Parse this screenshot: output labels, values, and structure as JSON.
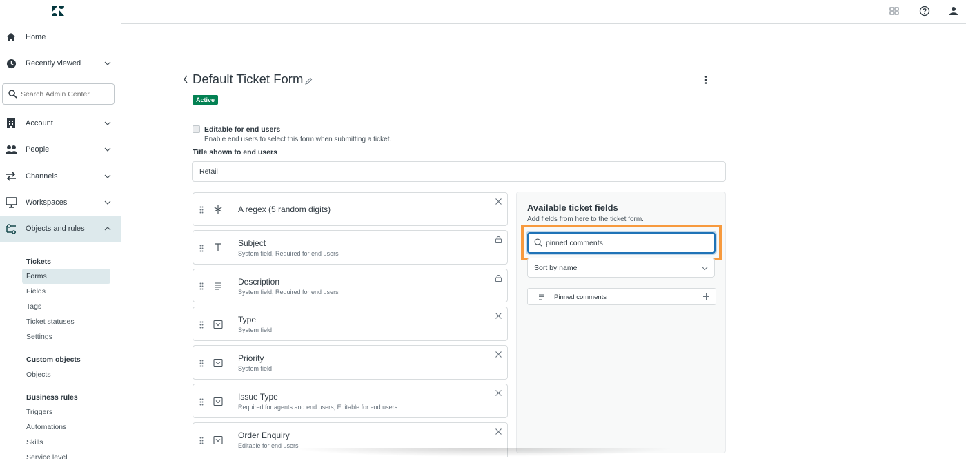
{
  "nav": {
    "home": "Home",
    "recently_viewed": "Recently viewed",
    "search_placeholder": "Search Admin Center",
    "account": "Account",
    "people": "People",
    "channels": "Channels",
    "workspaces": "Workspaces",
    "objects_and_rules": "Objects and rules"
  },
  "subnav": {
    "tickets_heading": "Tickets",
    "tickets_items": [
      "Forms",
      "Fields",
      "Tags",
      "Ticket statuses",
      "Settings"
    ],
    "custom_objects_heading": "Custom objects",
    "custom_objects_items": [
      "Objects"
    ],
    "business_rules_heading": "Business rules",
    "business_rules_items": [
      "Triggers",
      "Automations",
      "Skills",
      "Service level"
    ]
  },
  "form": {
    "title": "Default Ticket Form",
    "status_badge": "Active",
    "editable_label": "Editable for end users",
    "editable_hint": "Enable end users to select this form when submitting a ticket.",
    "title_label": "Title shown to end users",
    "title_value": "Retail"
  },
  "fields": [
    {
      "name": "A regex (5 random digits)",
      "sub": ""
    },
    {
      "name": "Subject",
      "sub": "System field, Required for end users"
    },
    {
      "name": "Description",
      "sub": "System field, Required for end users"
    },
    {
      "name": "Type",
      "sub": "System field"
    },
    {
      "name": "Priority",
      "sub": "System field"
    },
    {
      "name": "Issue Type",
      "sub": "Required for agents and end users, Editable for end users"
    },
    {
      "name": "Order Enquiry",
      "sub": "Editable for end users"
    }
  ],
  "panel": {
    "title": "Available ticket fields",
    "subtitle": "Add fields from here to the ticket form.",
    "search_value": "pinned comments",
    "sort_label": "Sort by name",
    "results": [
      "Pinned comments"
    ]
  },
  "colors": {
    "active_badge": "#038153",
    "highlight": "#f79a3e",
    "focus": "#1f73b7"
  }
}
